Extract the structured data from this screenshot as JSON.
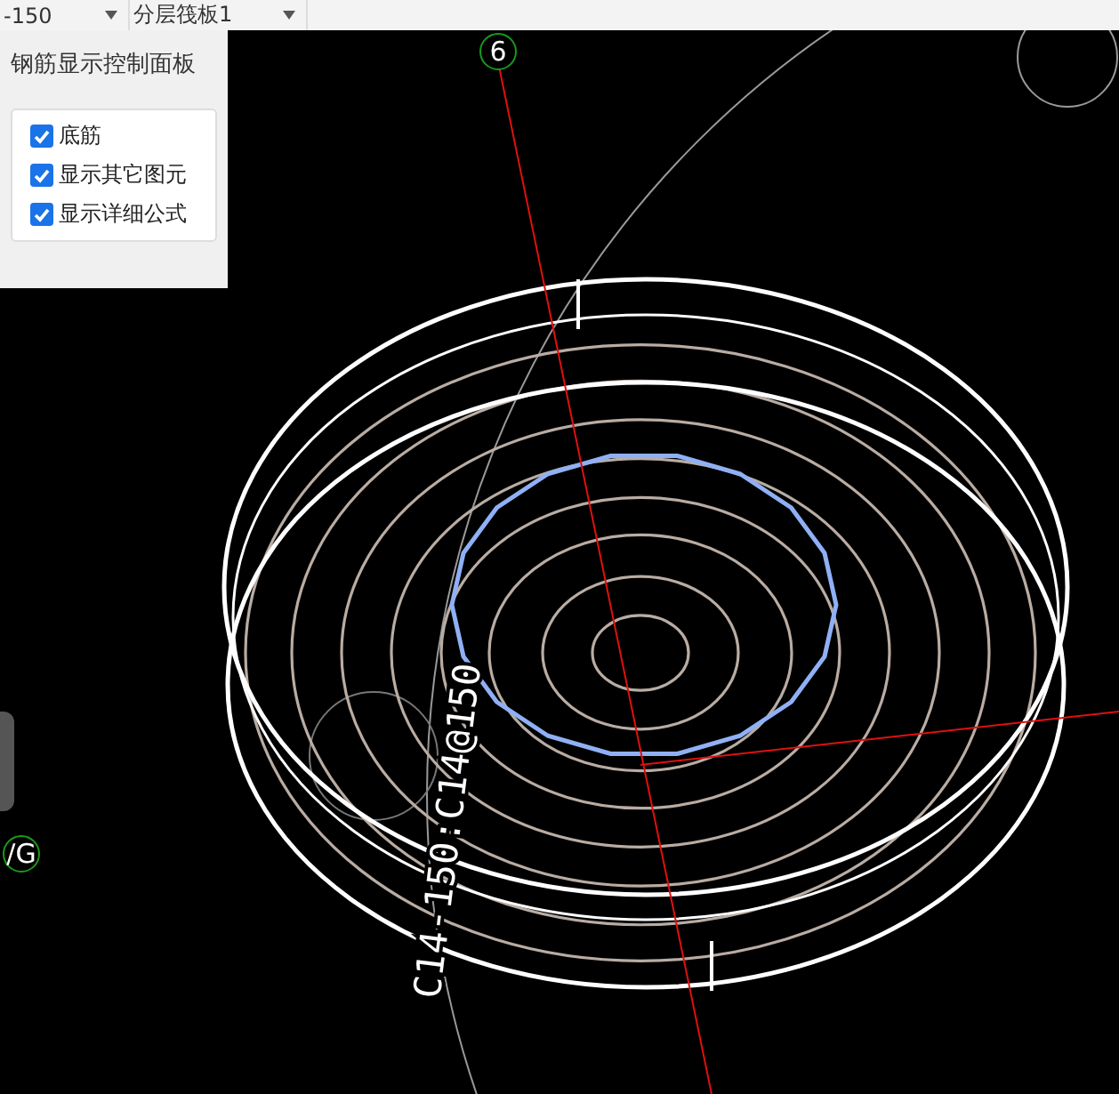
{
  "toolbar": {
    "dropdowns": [
      {
        "value": "-150"
      },
      {
        "value": "分层筏板1"
      }
    ]
  },
  "control_panel": {
    "title": "钢筋显示控制面板",
    "options": [
      {
        "label": "底筋",
        "checked": true
      },
      {
        "label": "显示其它图元",
        "checked": true
      },
      {
        "label": "显示详细公式",
        "checked": true
      }
    ]
  },
  "canvas": {
    "axis_labels": [
      "6",
      "/G"
    ],
    "rebar_label": "C14-150:C14@150"
  }
}
